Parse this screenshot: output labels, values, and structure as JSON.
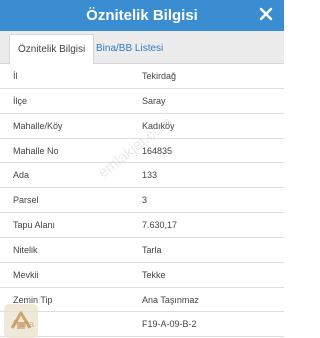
{
  "modal": {
    "title": "Öznitelik Bilgisi",
    "close_icon": "close-icon"
  },
  "tabs": [
    {
      "label": "Öznitelik Bilgisi",
      "active": true
    },
    {
      "label": "Bina/BB Listesi",
      "active": false
    }
  ],
  "rows": [
    {
      "key": "İl",
      "value": "Tekirdağ"
    },
    {
      "key": "İlçe",
      "value": "Saray"
    },
    {
      "key": "Mahalle/Köy",
      "value": "Kadıköy"
    },
    {
      "key": "Mahalle No",
      "value": "164835"
    },
    {
      "key": "Ada",
      "value": "133"
    },
    {
      "key": "Parsel",
      "value": "3"
    },
    {
      "key": "Tapu Alanı",
      "value": "7.630,17"
    },
    {
      "key": "Nitelik",
      "value": "Tarla"
    },
    {
      "key": "Mevkii",
      "value": "Tekke"
    },
    {
      "key": "Zemin Tip",
      "value": "Ana Taşınmaz"
    },
    {
      "key": "Pafta",
      "value": "F19-A-09-B-2"
    }
  ],
  "watermark": "emlakjet.com",
  "colors": {
    "header": "#3a8dd0",
    "tab_link": "#2f7cc2",
    "text": "#444444"
  }
}
